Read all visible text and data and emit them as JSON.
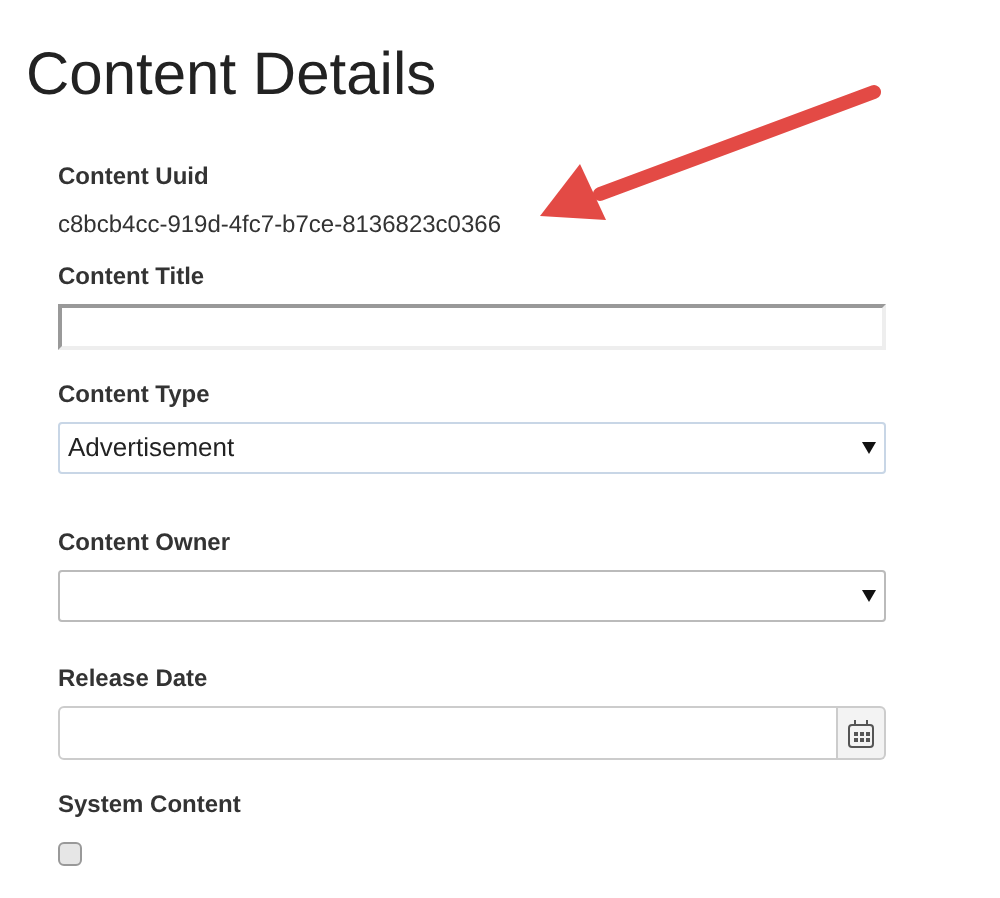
{
  "heading": "Content Details",
  "fields": [
    {
      "kind": "static",
      "label": "Content Uuid",
      "value": "c8bcb4cc-919d-4fc7-b7ce-8136823c0366"
    },
    {
      "kind": "text",
      "label": "Content Title"
    },
    {
      "kind": "select",
      "label": "Content Type",
      "value": "Advertisement"
    },
    {
      "kind": "select",
      "label": "Content Owner"
    },
    {
      "kind": "date",
      "label": "Release Date"
    },
    {
      "kind": "checkbox",
      "label": "System Content",
      "checked": false
    }
  ]
}
